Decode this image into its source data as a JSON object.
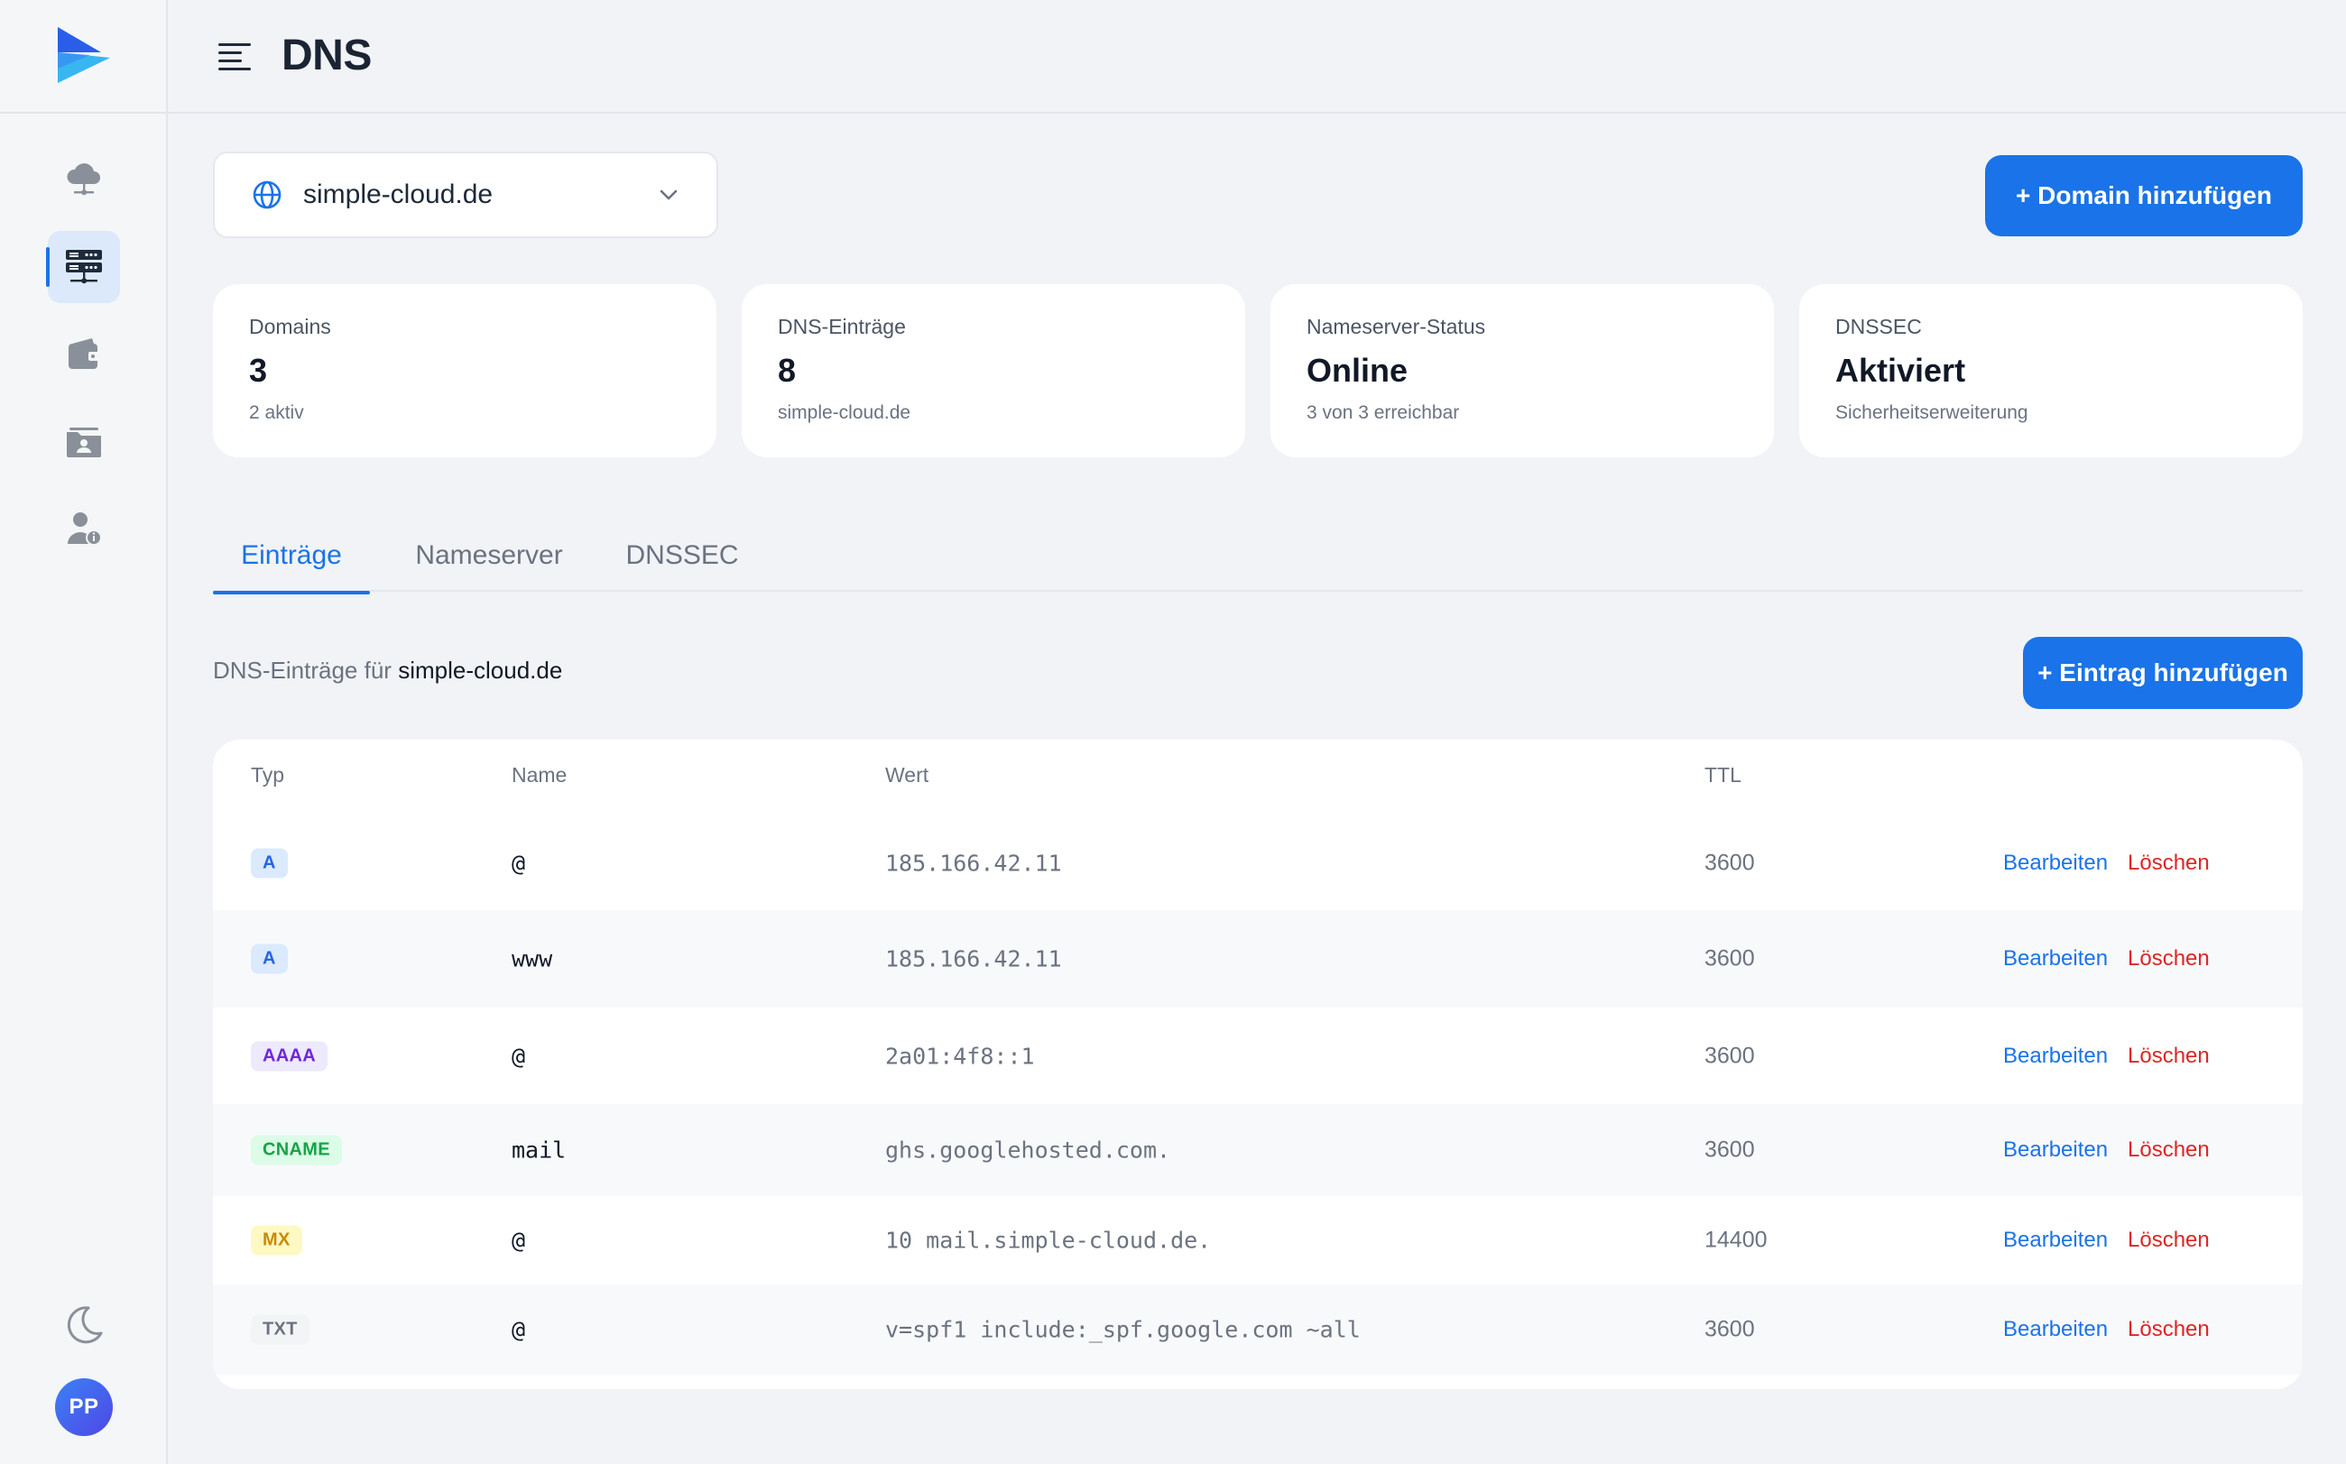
{
  "colors": {
    "accent": "#1a73e8",
    "danger": "#dc2626",
    "background": "#f1f3f6"
  },
  "header": {
    "title": "DNS"
  },
  "sidebar": {
    "items": [
      {
        "icon": "cloud-network-icon",
        "active": false
      },
      {
        "icon": "server-rack-icon",
        "active": true
      },
      {
        "icon": "wallet-icon",
        "active": false
      },
      {
        "icon": "folder-contacts-icon",
        "active": false
      },
      {
        "icon": "user-info-icon",
        "active": false
      }
    ],
    "theme_icon": "moon-icon",
    "avatar_initials": "PP"
  },
  "domain_select": {
    "value": "simple-cloud.de"
  },
  "add_domain_label": "+ Domain hinzufügen",
  "stats": [
    {
      "label": "Domains",
      "value": "3",
      "sub": "2 aktiv"
    },
    {
      "label": "DNS-Einträge",
      "value": "8",
      "sub": "simple-cloud.de"
    },
    {
      "label": "Nameserver-Status",
      "value": "Online",
      "sub": "3 von 3 erreichbar"
    },
    {
      "label": "DNSSEC",
      "value": "Aktiviert",
      "sub": "Sicherheitserweiterung"
    }
  ],
  "tabs": [
    {
      "label": "Einträge",
      "active": true
    },
    {
      "label": "Nameserver",
      "active": false
    },
    {
      "label": "DNSSEC",
      "active": false
    }
  ],
  "section": {
    "prefix": "DNS-Einträge für",
    "domain": "simple-cloud.de"
  },
  "add_entry_label": "+ Eintrag hinzufügen",
  "table": {
    "columns": [
      "Typ",
      "Name",
      "Wert",
      "TTL"
    ],
    "edit_label": "Bearbeiten",
    "delete_label": "Löschen",
    "rows": [
      {
        "type": "A",
        "name": "@",
        "value": "185.166.42.11",
        "ttl": "3600"
      },
      {
        "type": "A",
        "name": "www",
        "value": "185.166.42.11",
        "ttl": "3600"
      },
      {
        "type": "AAAA",
        "name": "@",
        "value": "2a01:4f8::1",
        "ttl": "3600"
      },
      {
        "type": "CNAME",
        "name": "mail",
        "value": "ghs.googlehosted.com.",
        "ttl": "3600"
      },
      {
        "type": "MX",
        "name": "@",
        "value": "10 mail.simple-cloud.de.",
        "ttl": "14400"
      },
      {
        "type": "TXT",
        "name": "@",
        "value": "v=spf1 include:_spf.google.com ~all",
        "ttl": "3600"
      }
    ]
  },
  "badge_colors": {
    "A": {
      "bg": "#dbeafe",
      "fg": "#2563eb"
    },
    "AAAA": {
      "bg": "#ede9fe",
      "fg": "#6d28d9"
    },
    "CNAME": {
      "bg": "#dcfce7",
      "fg": "#16a34a"
    },
    "MX": {
      "bg": "#fef9c3",
      "fg": "#ca8a04"
    },
    "TXT": {
      "bg": "#f3f4f6",
      "fg": "#6b7280"
    }
  }
}
